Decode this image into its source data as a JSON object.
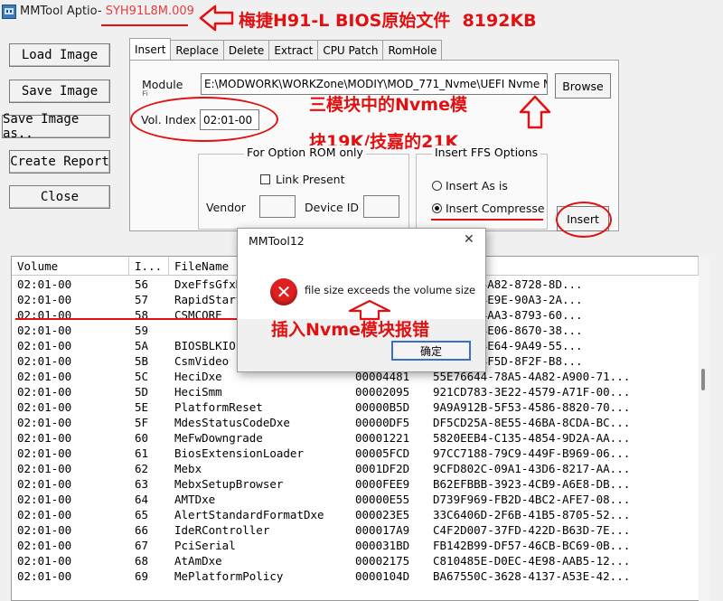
{
  "window": {
    "title_app": "MMTool Aptio-",
    "title_file": "SYH91L8M.009",
    "icon": "mmtool-app-icon"
  },
  "side_buttons": [
    {
      "label": "Load Image"
    },
    {
      "label": "Save Image"
    },
    {
      "label": "Save Image as.."
    },
    {
      "label": "Create Report"
    },
    {
      "label": "Close"
    }
  ],
  "tabs": [
    {
      "label": "Insert",
      "active": true
    },
    {
      "label": "Replace"
    },
    {
      "label": "Delete"
    },
    {
      "label": "Extract"
    },
    {
      "label": "CPU Patch"
    },
    {
      "label": "RomHole"
    }
  ],
  "insert_tab": {
    "module_label": "Module",
    "module_label_line2": "Fi",
    "module_path": "E:\\MODWORK\\WORKZone\\MODIY\\MOD_771_Nvme\\UEFI Nvme M",
    "browse_label": "Browse",
    "vol_index_label": "Vol. Index",
    "vol_index_value": "02:01-00",
    "option_rom": {
      "legend": "For Option ROM only",
      "link_present": "Link Present",
      "vendor_label": "Vendor",
      "device_id_label": "Device ID"
    },
    "ffs_options": {
      "legend": "Insert FFS Options",
      "insert_as_is": "Insert As is",
      "insert_compressed": "Insert Compressec",
      "selected": "Insert Compressed"
    },
    "insert_button": "Insert"
  },
  "table": {
    "columns": [
      "Volume",
      "I...",
      "FileName",
      "",
      ""
    ],
    "rows": [
      [
        "02:01-00",
        "56",
        "DxeFfsGfxD",
        "",
        "5-B5B9-4A82-8728-8D..."
      ],
      [
        "02:01-00",
        "57",
        "RapidStart",
        "",
        "6-E3F3-4E9E-90A3-2A..."
      ],
      [
        "02:01-00",
        "58",
        "CSMCORE",
        "",
        "F-8473-4AA3-8793-60..."
      ],
      [
        "02:01-00",
        "59",
        "",
        "",
        "C-A0FE-4E06-8670-38..."
      ],
      [
        "02:01-00",
        "5A",
        "BIOSBLKIO",
        "",
        "B-DD61-4E64-9A49-55..."
      ],
      [
        "02:01-00",
        "5B",
        "CsmVideo",
        "",
        "B-B675-4F5D-8F2F-B8..."
      ],
      [
        "02:01-00",
        "5C",
        "HeciDxe",
        "00004481",
        "55E76644-78A5-4A82-A900-71..."
      ],
      [
        "02:01-00",
        "5D",
        "HeciSmm",
        "00002095",
        "921CD783-3E22-4579-A71F-00..."
      ],
      [
        "02:01-00",
        "5E",
        "PlatformReset",
        "00000B5D",
        "9A9A912B-5F53-4586-8820-70..."
      ],
      [
        "02:01-00",
        "5F",
        "MdesStatusCodeDxe",
        "00000DF5",
        "DF5CD25A-8E55-46BA-8CDA-BC..."
      ],
      [
        "02:01-00",
        "60",
        "MeFwDowngrade",
        "00001221",
        "5820EEB4-C135-4854-9D2A-AA..."
      ],
      [
        "02:01-00",
        "61",
        "BiosExtensionLoader",
        "00005FCD",
        "97CC7188-79C9-449F-B969-06..."
      ],
      [
        "02:01-00",
        "62",
        "Mebx",
        "0001DF2D",
        "9CFD802C-09A1-43D6-8217-AA..."
      ],
      [
        "02:01-00",
        "63",
        "MebxSetupBrowser",
        "0000FEE9",
        "B62EFBBB-3923-4CB9-A6E8-DB..."
      ],
      [
        "02:01-00",
        "64",
        "AMTDxe",
        "00000E55",
        "D739F969-FB2D-4BC2-AFE7-08..."
      ],
      [
        "02:01-00",
        "65",
        "AlertStandardFormatDxe",
        "000023E5",
        "33C6406D-2F6B-41B5-8705-52..."
      ],
      [
        "02:01-00",
        "66",
        "IdeRController",
        "000017A9",
        "C4F2D007-37FD-422D-B63D-7E..."
      ],
      [
        "02:01-00",
        "67",
        "PciSerial",
        "000031BD",
        "FB142B99-DF57-46CB-BC69-0B..."
      ],
      [
        "02:01-00",
        "68",
        "AtAmDxe",
        "00002175",
        "C810485E-D0EC-4E98-AAB5-12..."
      ],
      [
        "02:01-00",
        "69",
        "MePlatformPolicy",
        "0000104D",
        "BA67550C-3628-4137-A53E-42..."
      ]
    ]
  },
  "dialog": {
    "title": "MMTool12",
    "message": "file size exceeds the volume size",
    "ok_label": "确定",
    "close_glyph": "✕",
    "icon": "error-icon"
  },
  "annotations": {
    "title_note": "梅捷H91-L BIOS原始文件  8192KB",
    "module_note_line1": "三模块中的Nvme模",
    "module_note_line2": "块19K/技嘉的21K",
    "error_note": "插入Nvme模块报错"
  },
  "colors": {
    "annotation_red": "#e21010",
    "error_red": "#e02020",
    "title_file_color": "#e04040"
  }
}
